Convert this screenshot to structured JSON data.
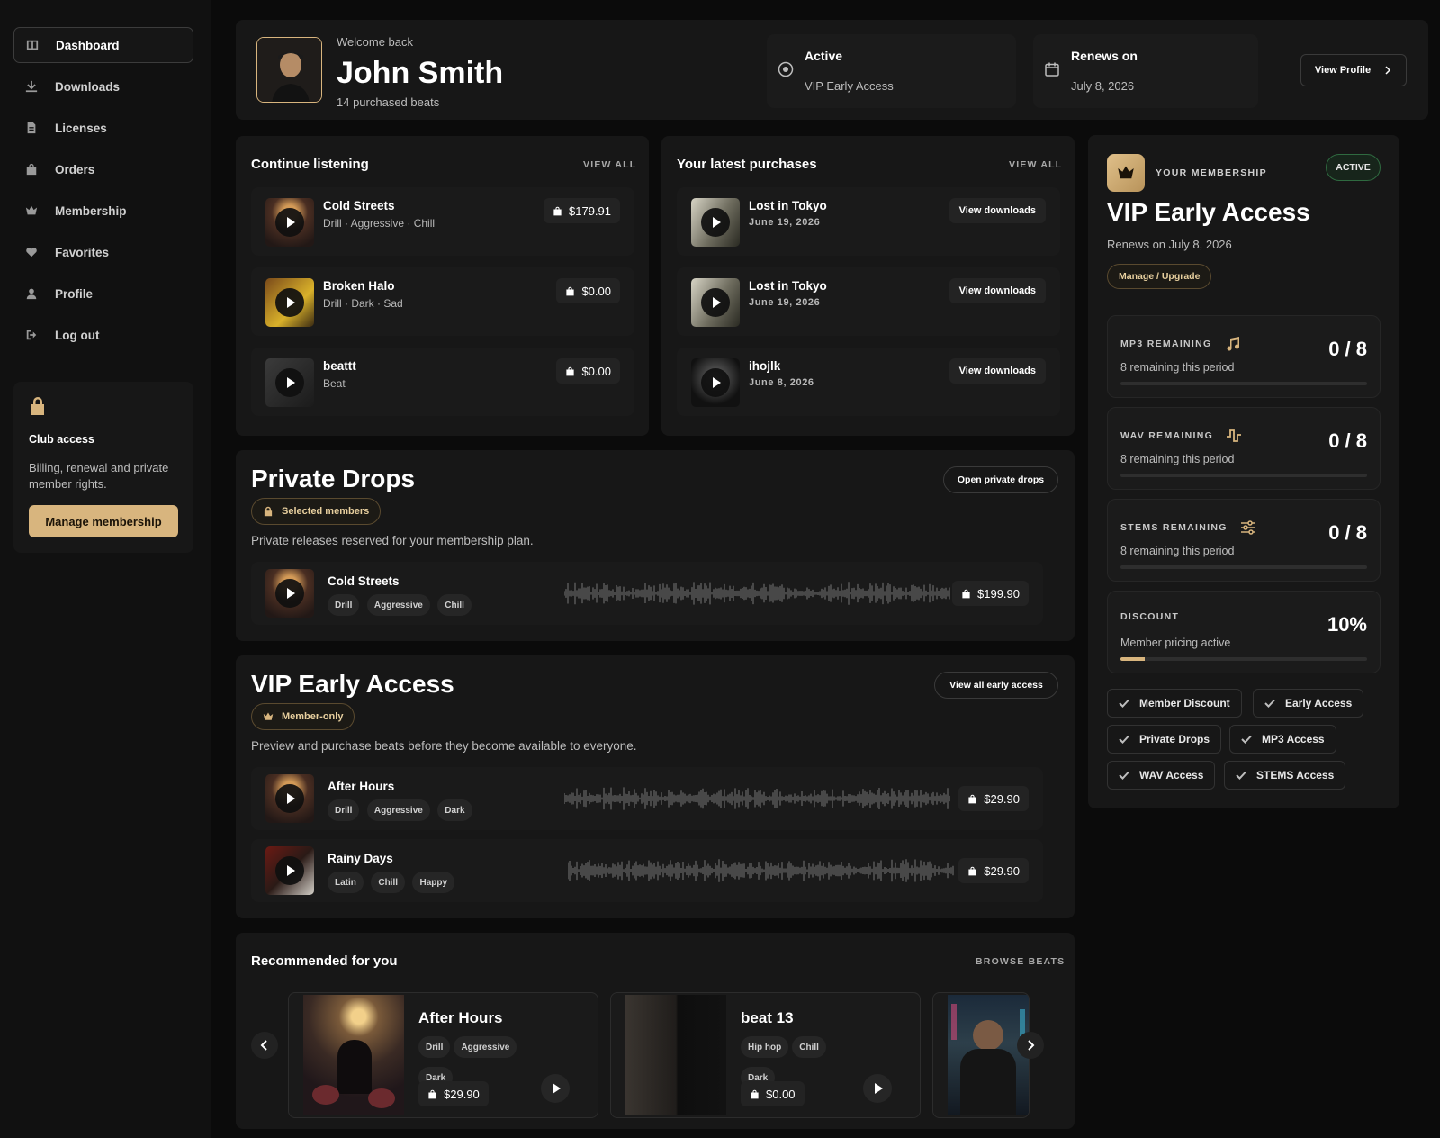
{
  "sidebar": {
    "items": [
      {
        "label": "Dashboard",
        "icon": "dashboard-icon"
      },
      {
        "label": "Downloads",
        "icon": "download-icon"
      },
      {
        "label": "Licenses",
        "icon": "document-icon"
      },
      {
        "label": "Orders",
        "icon": "bag-icon"
      },
      {
        "label": "Membership",
        "icon": "crown-icon"
      },
      {
        "label": "Favorites",
        "icon": "heart-icon"
      },
      {
        "label": "Profile",
        "icon": "user-icon"
      },
      {
        "label": "Log out",
        "icon": "logout-icon"
      }
    ],
    "club": {
      "title": "Club access",
      "text": "Billing, renewal and private member rights.",
      "button": "Manage membership"
    }
  },
  "header": {
    "welcome": "Welcome back",
    "name": "John Smith",
    "purchased": "14 purchased beats",
    "status_title": "Active",
    "status_value": "VIP Early Access",
    "renew_title": "Renews on",
    "renew_value": "July 8, 2026",
    "view_profile": "View Profile"
  },
  "continue": {
    "title": "Continue listening",
    "view_all": "VIEW ALL",
    "items": [
      {
        "title": "Cold Streets",
        "sub": "Drill · Aggressive · Chill",
        "price": "$179.91"
      },
      {
        "title": "Broken Halo",
        "sub": "Drill · Dark · Sad",
        "price": "$0.00"
      },
      {
        "title": "beattt",
        "sub": "Beat",
        "price": "$0.00"
      }
    ]
  },
  "purchases": {
    "title": "Your latest purchases",
    "view_all": "VIEW ALL",
    "items": [
      {
        "title": "Lost in Tokyo",
        "date": "June 19, 2026",
        "action": "View downloads"
      },
      {
        "title": "Lost in Tokyo",
        "date": "June 19, 2026",
        "action": "View downloads"
      },
      {
        "title": "ihojlk",
        "date": "June 8, 2026",
        "action": "View downloads"
      }
    ]
  },
  "private_drops": {
    "title": "Private Drops",
    "badge": "Selected members",
    "button": "Open private drops",
    "desc": "Private releases reserved for your membership plan.",
    "items": [
      {
        "title": "Cold Streets",
        "tags": [
          "Drill",
          "Aggressive",
          "Chill"
        ],
        "price": "$199.90"
      }
    ]
  },
  "vip": {
    "title": "VIP Early Access",
    "badge": "Member-only",
    "button": "View all early access",
    "desc": "Preview and purchase beats before they become available to everyone.",
    "items": [
      {
        "title": "After Hours",
        "tags": [
          "Drill",
          "Aggressive",
          "Dark"
        ],
        "price": "$29.90"
      },
      {
        "title": "Rainy Days",
        "tags": [
          "Latin",
          "Chill",
          "Happy"
        ],
        "price": "$29.90"
      }
    ]
  },
  "recommended": {
    "title": "Recommended for you",
    "browse": "BROWSE BEATS",
    "items": [
      {
        "title": "After Hours",
        "tags": [
          "Drill",
          "Aggressive",
          "Dark"
        ],
        "price": "$29.90"
      },
      {
        "title": "beat 13",
        "tags": [
          "Hip hop",
          "Chill",
          "Dark"
        ],
        "price": "$0.00"
      }
    ]
  },
  "membership": {
    "label": "YOUR MEMBERSHIP",
    "status": "ACTIVE",
    "plan": "VIP Early Access",
    "renews": "Renews on July 8, 2026",
    "manage": "Manage / Upgrade",
    "quotas": [
      {
        "label": "MP3 REMAINING",
        "icon": "music-note-icon",
        "sub": "8 remaining this period",
        "value": "0 / 8",
        "fill": 0
      },
      {
        "label": "WAV REMAINING",
        "icon": "waveform-icon",
        "sub": "8 remaining this period",
        "value": "0 / 8",
        "fill": 0
      },
      {
        "label": "STEMS REMAINING",
        "icon": "sliders-icon",
        "sub": "8 remaining this period",
        "value": "0 / 8",
        "fill": 0
      },
      {
        "label": "DISCOUNT",
        "icon": "",
        "sub": "Member pricing active",
        "value": "10%",
        "fill": 0.1
      }
    ],
    "perks": [
      "Member Discount",
      "Early Access",
      "Private Drops",
      "MP3 Access",
      "WAV Access",
      "STEMS Access"
    ]
  },
  "colors": {
    "accent": "#d8b57e",
    "background": "#0b0b0b",
    "card": "#171717",
    "active_green": "#2f6a40"
  }
}
